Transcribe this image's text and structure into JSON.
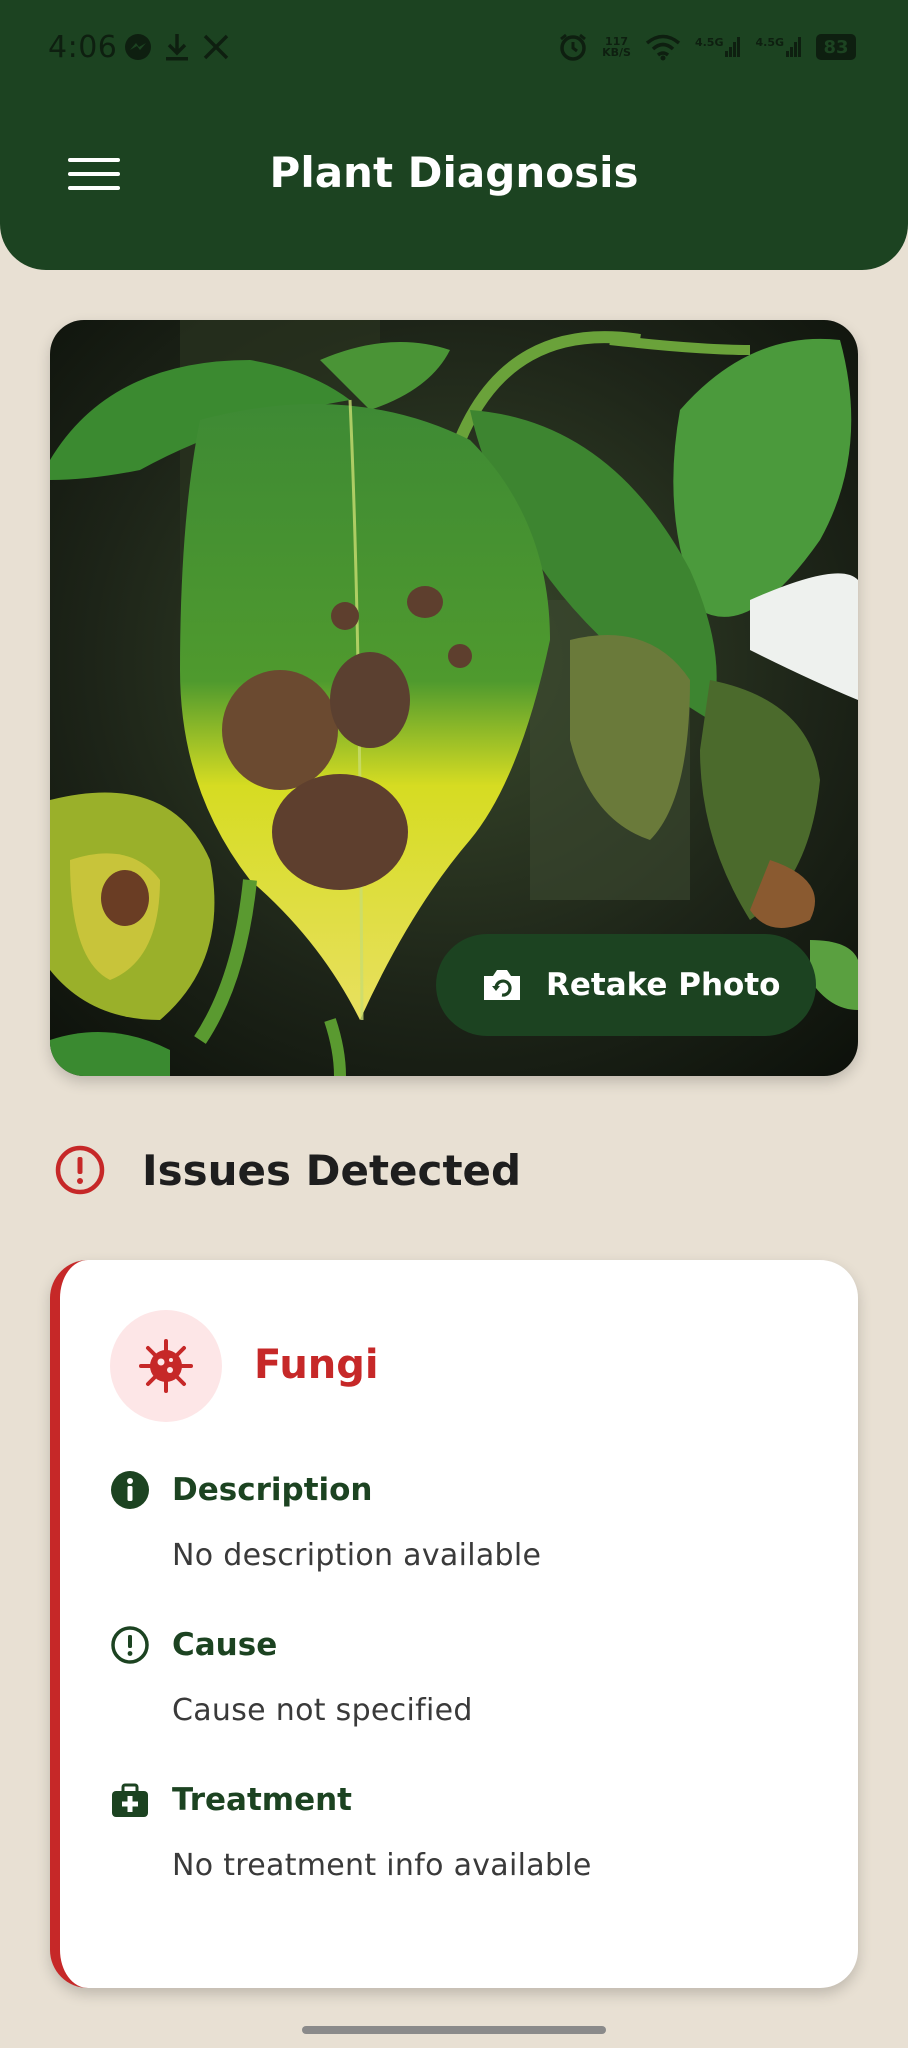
{
  "status_bar": {
    "time": "4:06",
    "net_speed_value": "117",
    "net_speed_unit": "KB/S",
    "signal1": "4.5G",
    "signal2": "4.5G",
    "battery": "83"
  },
  "app_bar": {
    "title": "Plant Diagnosis"
  },
  "photo": {
    "retake_label": "Retake Photo"
  },
  "issues": {
    "title": "Issues Detected",
    "items": [
      {
        "name": "Fungi",
        "description_label": "Description",
        "description_text": "No description available",
        "cause_label": "Cause",
        "cause_text": "Cause not specified",
        "treatment_label": "Treatment",
        "treatment_text": "No treatment info available"
      }
    ]
  },
  "colors": {
    "primary": "#1c4321",
    "background": "#e8e0d3",
    "danger": "#c62828",
    "danger_soft": "#fde6e7"
  }
}
